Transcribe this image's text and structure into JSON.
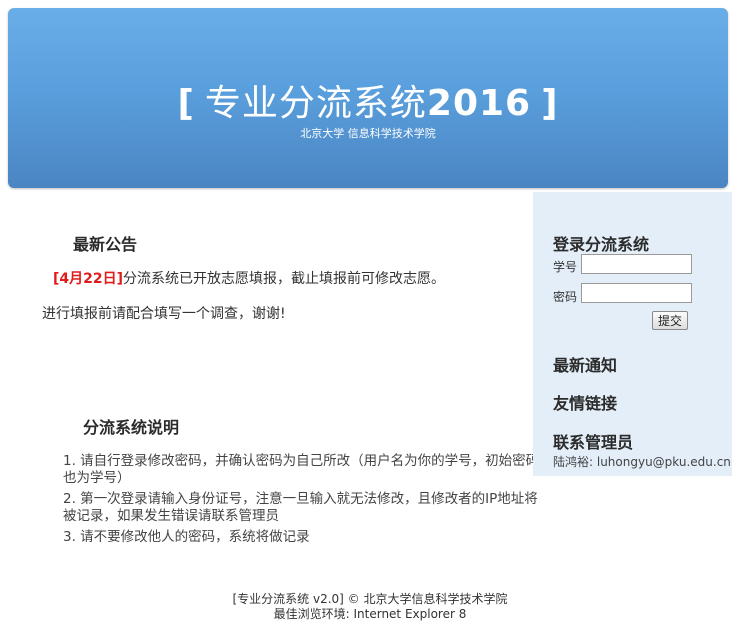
{
  "header": {
    "bracket_open": "[",
    "title": "专业分流系统",
    "year": "2016",
    "bracket_close": "]",
    "subtitle": "北京大学 信息科学技术学院"
  },
  "announcement": {
    "heading": "最新公告",
    "date": "[4月22日]",
    "line1": "分流系统已开放志愿填报，截止填报前可修改志愿。",
    "line2": "进行填报前请配合填写一个调查，谢谢!"
  },
  "instructions": {
    "heading": "分流系统说明",
    "items": [
      "1. 请自行登录修改密码，并确认密码为自己所改（用户名为你的学号，初始密码也为学号）",
      "2. 第一次登录请输入身份证号，注意一旦输入就无法修改，且修改者的IP地址将被记录，如果发生错误请联系管理员",
      "3. 请不要修改他人的密码，系统将做记录"
    ]
  },
  "sidebar": {
    "login_heading": "登录分流系统",
    "student_id_label": "学号",
    "student_id_value": "",
    "password_label": "密码",
    "password_value": "",
    "submit_label": "提交",
    "notices_heading": "最新通知",
    "links_heading": "友情链接",
    "contact_heading": "联系管理员",
    "contact_text": "陆鸿裕: luhongyu@pku.edu.cn"
  },
  "footer": {
    "line1": "[专业分流系统 v2.0] © 北京大学信息科学技术学院",
    "line2": "最佳浏览环境: Internet Explorer 8"
  }
}
